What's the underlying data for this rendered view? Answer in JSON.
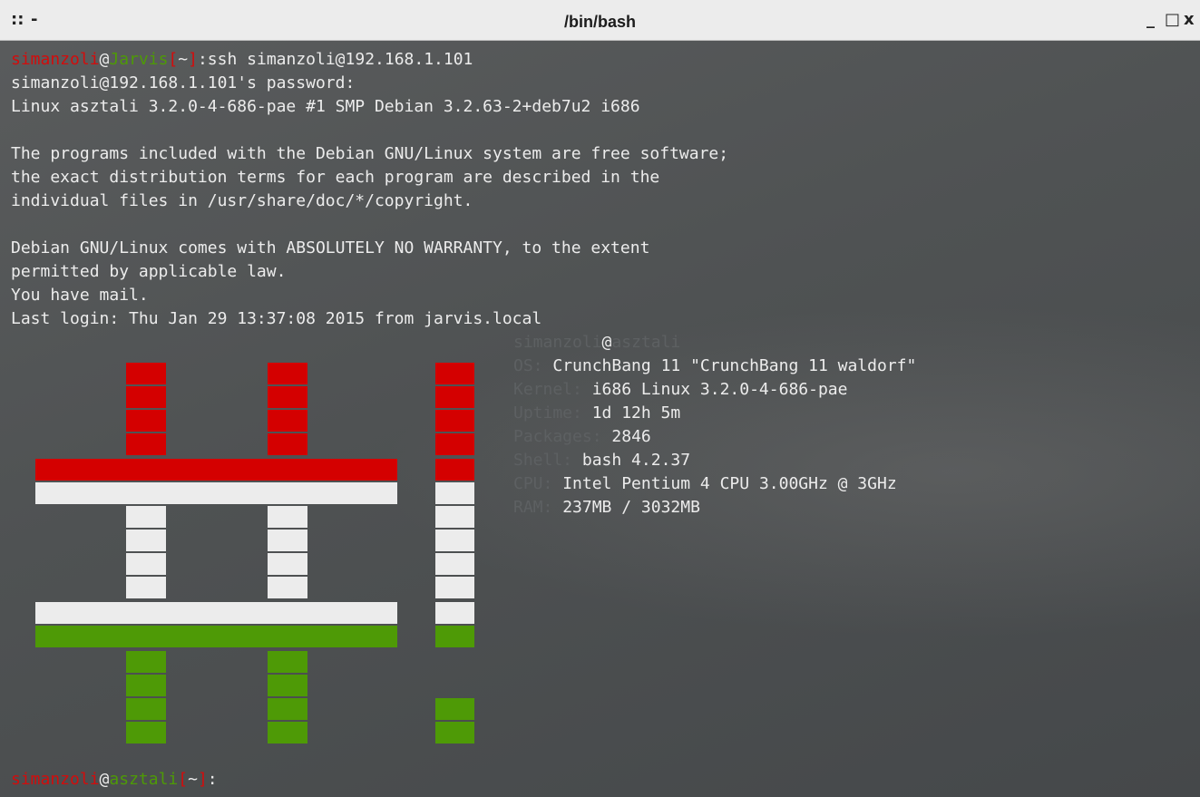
{
  "window": {
    "title": "/bin/bash",
    "menu_icon": "::",
    "dash_icon": "-",
    "minimize_glyph": "_",
    "maximize_glyph": "□",
    "close_glyph": "x"
  },
  "colors": {
    "user_red": "#d30c0c",
    "host_green": "#4e9a06",
    "text": "#ececec",
    "label_dim": "#5d6062",
    "logo_red": "#d40000",
    "logo_white": "#ececec",
    "logo_green": "#4e9a06"
  },
  "prompt1": {
    "user": "simanzoli",
    "at": "@",
    "host": "Jarvis",
    "dir_open": "[",
    "dir": "~",
    "dir_close": "]",
    "sep": ":",
    "command": "ssh simanzoli@192.168.1.101"
  },
  "output": [
    "simanzoli@192.168.1.101's password:",
    "Linux asztali 3.2.0-4-686-pae #1 SMP Debian 3.2.63-2+deb7u2 i686",
    "",
    "The programs included with the Debian GNU/Linux system are free software;",
    "the exact distribution terms for each program are described in the",
    "individual files in /usr/share/doc/*/copyright.",
    "",
    "Debian GNU/Linux comes with ABSOLUTELY NO WARRANTY, to the extent",
    "permitted by applicable law.",
    "You have mail.",
    "Last login: Thu Jan 29 13:37:08 2015 from jarvis.local"
  ],
  "screenfetch": {
    "user": "simanzoli",
    "at": "@",
    "host": "asztali",
    "rows": [
      {
        "label": "OS:",
        "value": "CrunchBang 11 \"CrunchBang 11 waldorf\""
      },
      {
        "label": "Kernel:",
        "value": "i686 Linux 3.2.0-4-686-pae"
      },
      {
        "label": "Uptime:",
        "value": "1d 12h 5m"
      },
      {
        "label": "Packages:",
        "value": "2846"
      },
      {
        "label": "Shell:",
        "value": "bash 4.2.37"
      },
      {
        "label": "CPU:",
        "value": "Intel Pentium 4 CPU 3.00GHz @ 3GHz"
      },
      {
        "label": "RAM:",
        "value": "237MB / 3032MB"
      }
    ]
  },
  "prompt2": {
    "user": "simanzoli",
    "at": "@",
    "host": "asztali",
    "dir_open": "[",
    "dir": "~",
    "dir_close": "]",
    "sep": ":"
  }
}
